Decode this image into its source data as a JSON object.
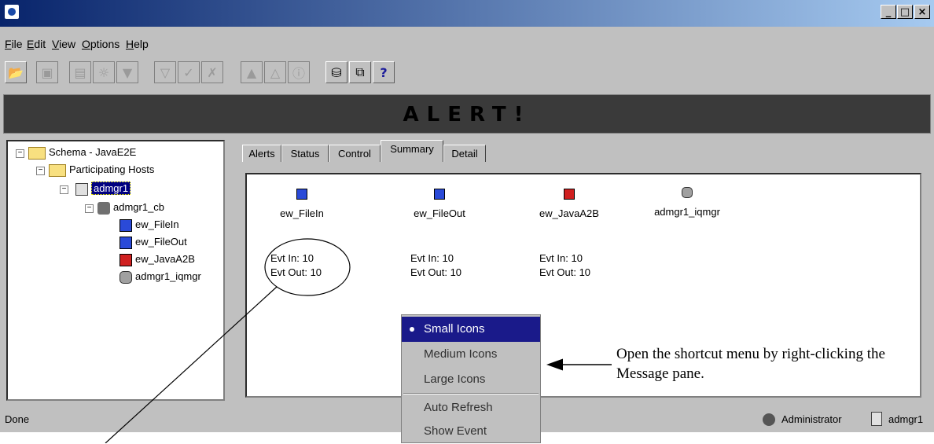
{
  "menubar": {
    "items": [
      "File",
      "Edit",
      "View",
      "Options",
      "Help"
    ]
  },
  "toolbar": {
    "buttons": [
      "open-icon",
      "properties-icon",
      "list-icon",
      "bulb-icon",
      "comment-icon",
      "filter-icon",
      "check-icon",
      "check-off-icon",
      "warning-icon",
      "warning-outline-icon",
      "info-icon",
      "database-icon",
      "copy-icon",
      "help-icon"
    ]
  },
  "alert": {
    "text": "ALERT!"
  },
  "tree": {
    "root": "Schema - JavaE2E",
    "hosts": "Participating Hosts",
    "host": "admgr1",
    "cb": "admgr1_cb",
    "leaves": [
      "ew_FileIn",
      "ew_FileOut",
      "ew_JavaA2B",
      "admgr1_iqmgr"
    ]
  },
  "tabs": [
    "Alerts",
    "Status",
    "Control",
    "Summary",
    "Detail"
  ],
  "summary": {
    "modules": [
      {
        "name": "ew_FileIn",
        "evt_in": "Evt In: 10",
        "evt_out": "Evt Out: 10"
      },
      {
        "name": "ew_FileOut",
        "evt_in": "Evt In: 10",
        "evt_out": "Evt Out: 10"
      },
      {
        "name": "ew_JavaA2B",
        "evt_in": "Evt In: 10",
        "evt_out": "Evt Out: 10"
      },
      {
        "name": "admgr1_iqmgr"
      }
    ]
  },
  "context_menu": {
    "items": [
      "Small Icons",
      "Medium Icons",
      "Large Icons",
      "Auto Refresh",
      "Show Event"
    ],
    "selected": "Small Icons"
  },
  "callout": {
    "text": "Open the shortcut menu by right-clicking the Message pane."
  },
  "status": {
    "text": "Done",
    "user": "Administrator",
    "host": "admgr1"
  }
}
